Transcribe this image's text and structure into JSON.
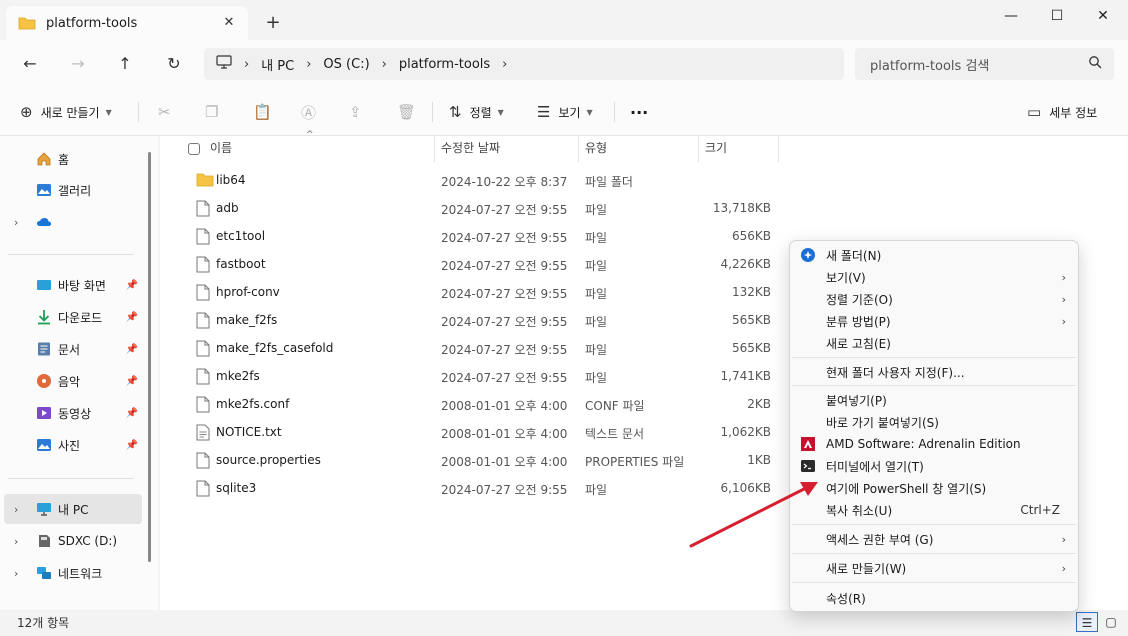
{
  "window": {
    "tab_title": "platform-tools",
    "tab_close": "✕",
    "new_tab": "+",
    "minimize": "—",
    "maximize": "☐",
    "close": "✕"
  },
  "nav": {
    "back": "←",
    "forward": "→",
    "up": "↑",
    "refresh": "↻",
    "breadcrumbs": [
      "내 PC",
      "OS (C:)",
      "platform-tools"
    ],
    "search_placeholder": "platform-tools 검색"
  },
  "commands": {
    "new": "새로 만들기",
    "sort": "정렬",
    "view": "보기",
    "more": "···",
    "details": "세부 정보"
  },
  "sidebar": {
    "items": [
      {
        "label": "홈"
      },
      {
        "label": "갤러리"
      },
      {
        "label": ""
      },
      {
        "label": "바탕 화면"
      },
      {
        "label": "다운로드"
      },
      {
        "label": "문서"
      },
      {
        "label": "음악"
      },
      {
        "label": "동영상"
      },
      {
        "label": "사진"
      },
      {
        "label": "내 PC"
      },
      {
        "label": "SDXC (D:)"
      },
      {
        "label": "네트워크"
      }
    ]
  },
  "columns": {
    "name": "이름",
    "date": "수정한 날짜",
    "type": "유형",
    "size": "크기"
  },
  "files": [
    {
      "name": "lib64",
      "date": "2024-10-22 오후 8:37",
      "type": "파일 폴더",
      "size": "",
      "icon": "folder-icon"
    },
    {
      "name": "adb",
      "date": "2024-07-27 오전 9:55",
      "type": "파일",
      "size": "13,718KB",
      "icon": "file-icon"
    },
    {
      "name": "etc1tool",
      "date": "2024-07-27 오전 9:55",
      "type": "파일",
      "size": "656KB",
      "icon": "file-icon"
    },
    {
      "name": "fastboot",
      "date": "2024-07-27 오전 9:55",
      "type": "파일",
      "size": "4,226KB",
      "icon": "file-icon"
    },
    {
      "name": "hprof-conv",
      "date": "2024-07-27 오전 9:55",
      "type": "파일",
      "size": "132KB",
      "icon": "file-icon"
    },
    {
      "name": "make_f2fs",
      "date": "2024-07-27 오전 9:55",
      "type": "파일",
      "size": "565KB",
      "icon": "file-icon"
    },
    {
      "name": "make_f2fs_casefold",
      "date": "2024-07-27 오전 9:55",
      "type": "파일",
      "size": "565KB",
      "icon": "file-icon"
    },
    {
      "name": "mke2fs",
      "date": "2024-07-27 오전 9:55",
      "type": "파일",
      "size": "1,741KB",
      "icon": "file-icon"
    },
    {
      "name": "mke2fs.conf",
      "date": "2008-01-01 오후 4:00",
      "type": "CONF 파일",
      "size": "2KB",
      "icon": "file-icon"
    },
    {
      "name": "NOTICE.txt",
      "date": "2008-01-01 오후 4:00",
      "type": "텍스트 문서",
      "size": "1,062KB",
      "icon": "text-file-icon"
    },
    {
      "name": "source.properties",
      "date": "2008-01-01 오후 4:00",
      "type": "PROPERTIES 파일",
      "size": "1KB",
      "icon": "file-icon"
    },
    {
      "name": "sqlite3",
      "date": "2024-07-27 오전 9:55",
      "type": "파일",
      "size": "6,106KB",
      "icon": "file-icon"
    }
  ],
  "status": {
    "count": "12개 항목"
  },
  "context_menu": {
    "items": [
      {
        "label": "새 폴더(N)",
        "arrow": "",
        "shortcut": ""
      },
      {
        "label": "보기(V)",
        "arrow": "›",
        "shortcut": ""
      },
      {
        "label": "정렬 기준(O)",
        "arrow": "›",
        "shortcut": ""
      },
      {
        "label": "분류 방법(P)",
        "arrow": "›",
        "shortcut": ""
      },
      {
        "label": "새로 고침(E)",
        "arrow": "",
        "shortcut": ""
      },
      {
        "label": "현재 폴더 사용자 지정(F)...",
        "arrow": "",
        "shortcut": ""
      },
      {
        "label": "붙여넣기(P)",
        "arrow": "",
        "shortcut": ""
      },
      {
        "label": "바로 가기 붙여넣기(S)",
        "arrow": "",
        "shortcut": ""
      },
      {
        "label": "AMD Software: Adrenalin Edition",
        "arrow": "",
        "shortcut": ""
      },
      {
        "label": "터미널에서 열기(T)",
        "arrow": "",
        "shortcut": ""
      },
      {
        "label": "여기에 PowerShell 창 열기(S)",
        "arrow": "",
        "shortcut": ""
      },
      {
        "label": "복사 취소(U)",
        "arrow": "",
        "shortcut": "Ctrl+Z"
      },
      {
        "label": "액세스 권한 부여 (G)",
        "arrow": "›",
        "shortcut": ""
      },
      {
        "label": "새로 만들기(W)",
        "arrow": "›",
        "shortcut": ""
      },
      {
        "label": "속성(R)",
        "arrow": "",
        "shortcut": ""
      }
    ]
  },
  "colors": {
    "accent": "#0067c0",
    "annotation_arrow": "#d6202f",
    "folder": "#f6c342"
  }
}
